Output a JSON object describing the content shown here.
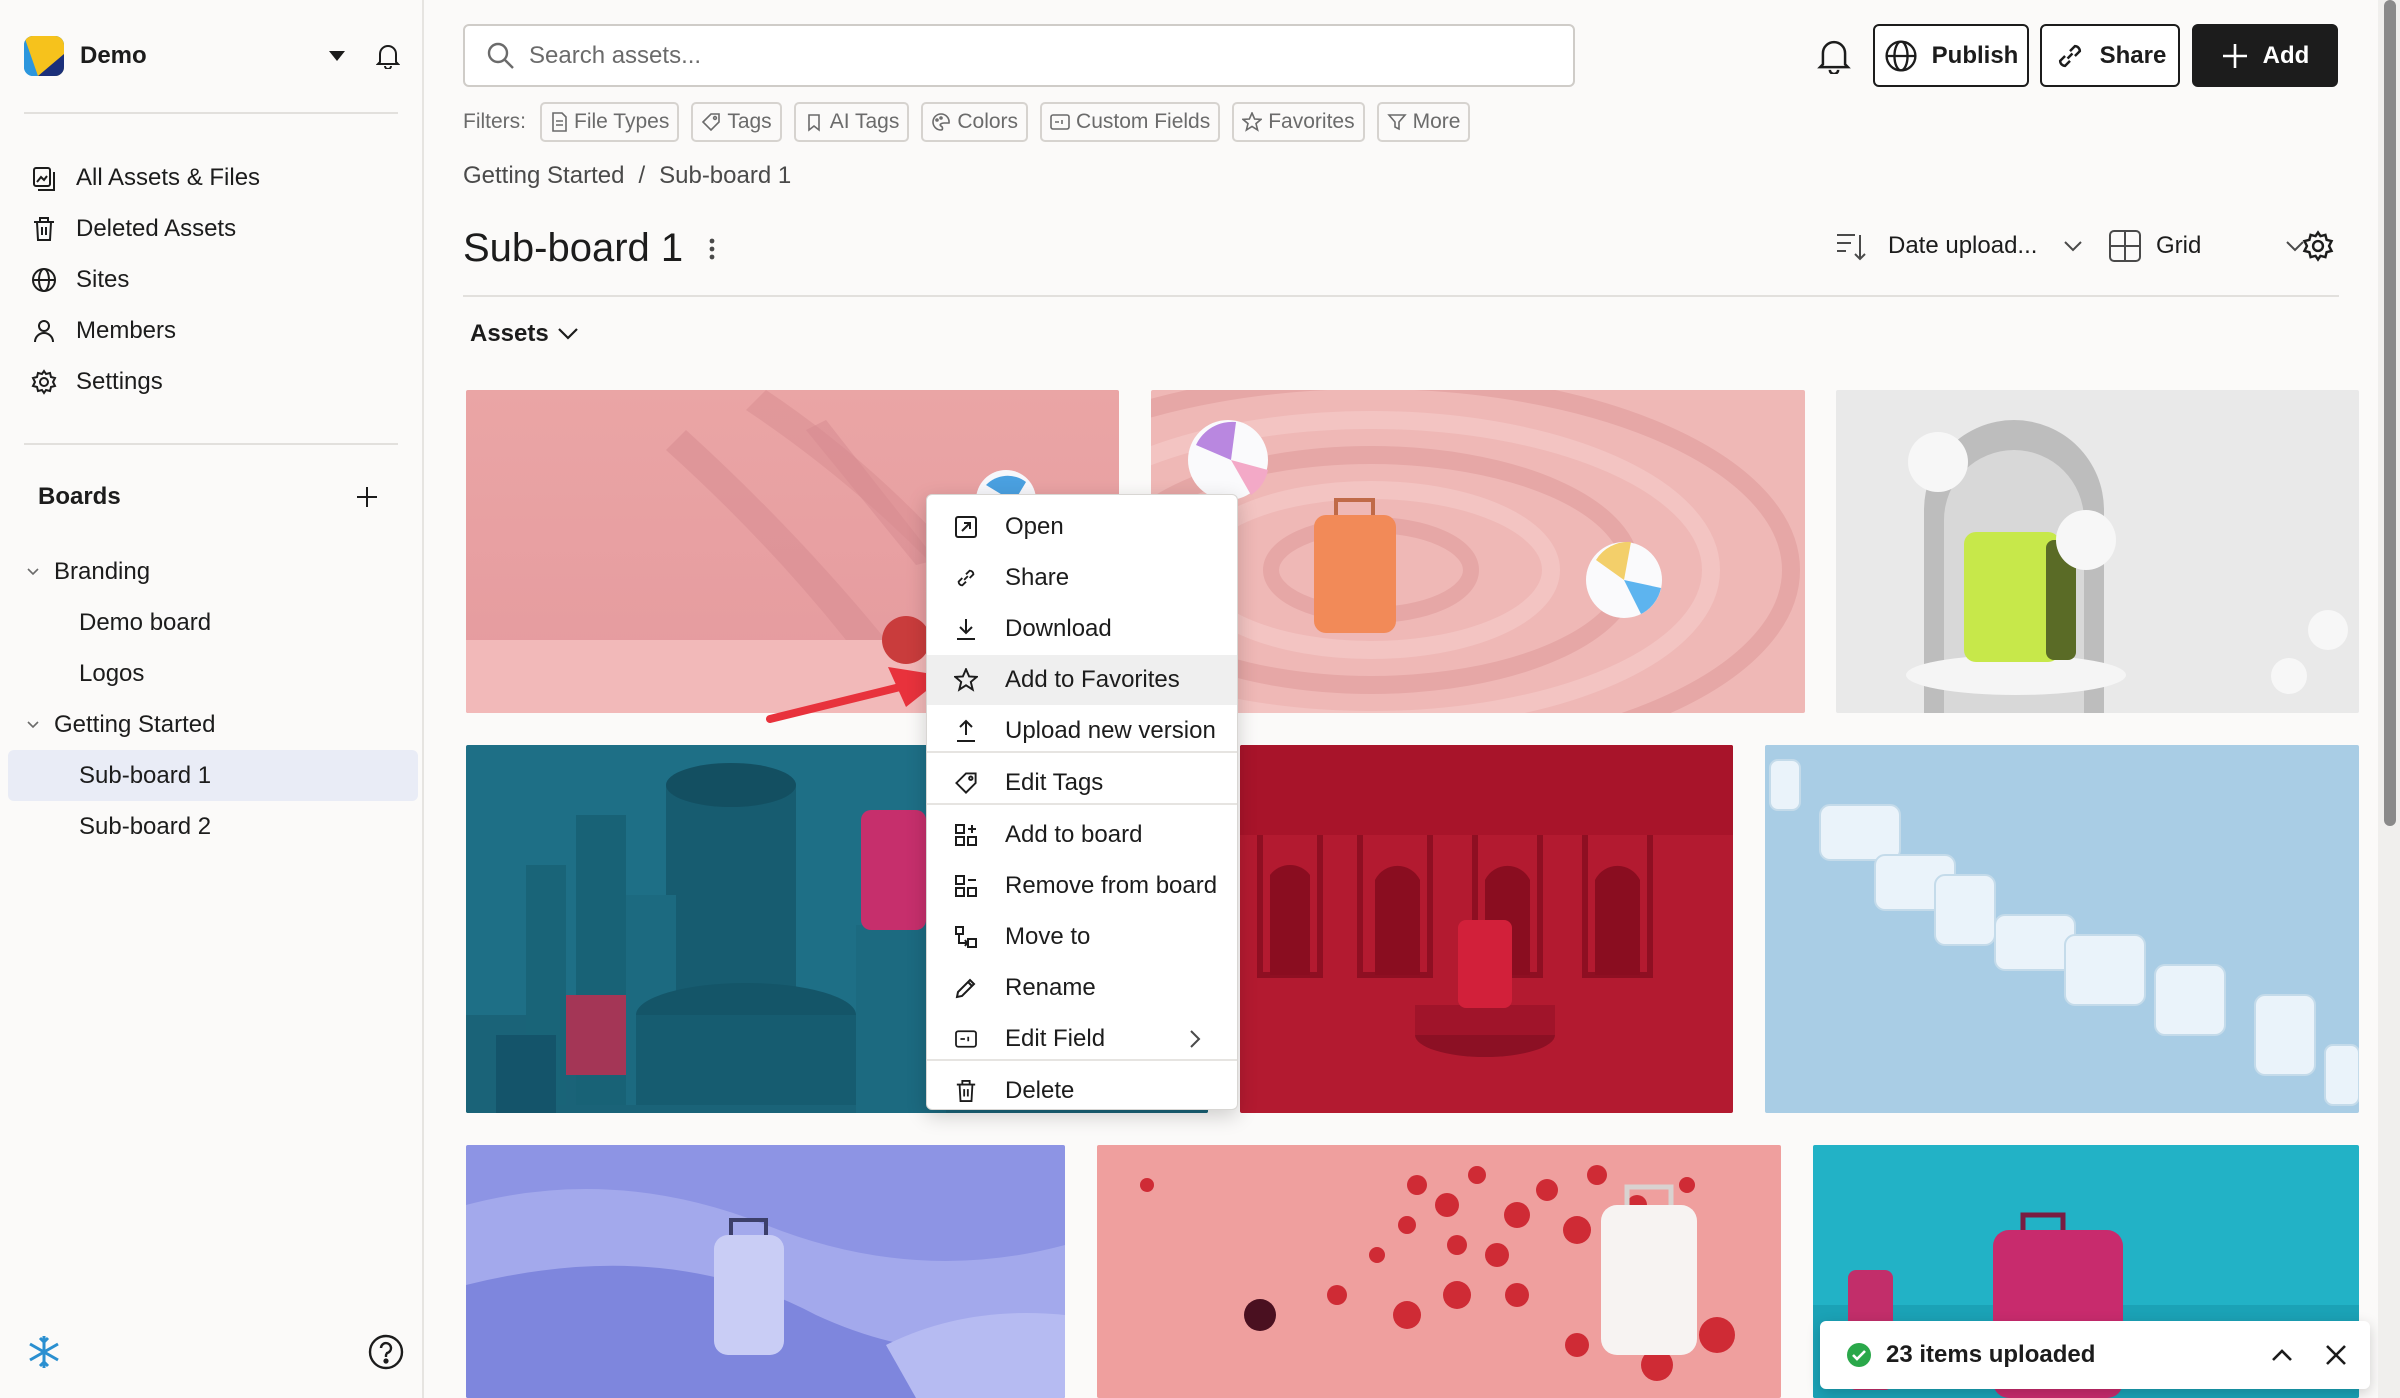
{
  "workspace": {
    "name": "Demo"
  },
  "nav": [
    {
      "label": "All Assets & Files",
      "icon": "assets-icon"
    },
    {
      "label": "Deleted Assets",
      "icon": "trash-icon"
    },
    {
      "label": "Sites",
      "icon": "globe-icon"
    },
    {
      "label": "Members",
      "icon": "person-icon"
    },
    {
      "label": "Settings",
      "icon": "gear-icon"
    }
  ],
  "boards": {
    "heading": "Boards",
    "tree": [
      {
        "label": "Branding",
        "level": 1,
        "expanded": true
      },
      {
        "label": "Demo board",
        "level": 2
      },
      {
        "label": "Logos",
        "level": 2
      },
      {
        "label": "Getting Started",
        "level": 1,
        "expanded": true
      },
      {
        "label": "Sub-board 1",
        "level": 2,
        "active": true
      },
      {
        "label": "Sub-board 2",
        "level": 2
      }
    ]
  },
  "search": {
    "placeholder": "Search assets..."
  },
  "header_buttons": {
    "publish": "Publish",
    "share": "Share",
    "add": "Add"
  },
  "filters": {
    "label": "Filters:",
    "chips": [
      "File Types",
      "Tags",
      "AI Tags",
      "Colors",
      "Custom Fields",
      "Favorites",
      "More"
    ]
  },
  "breadcrumb": [
    "Getting Started",
    "Sub-board 1"
  ],
  "page_title": "Sub-board 1",
  "toolbar": {
    "sort": "Date upload...",
    "view": "Grid"
  },
  "section": {
    "assets_label": "Assets"
  },
  "context_menu": {
    "items": [
      {
        "label": "Open",
        "icon": "open-icon"
      },
      {
        "label": "Share",
        "icon": "link-icon"
      },
      {
        "label": "Download",
        "icon": "download-icon"
      },
      {
        "label": "Add to Favorites",
        "icon": "star-icon",
        "highlighted": true
      },
      {
        "label": "Upload new version",
        "icon": "upload-icon"
      },
      {
        "label": "Edit Tags",
        "icon": "tag-icon"
      },
      {
        "label": "Add to board",
        "icon": "add-board-icon"
      },
      {
        "label": "Remove from board",
        "icon": "remove-board-icon"
      },
      {
        "label": "Move to",
        "icon": "move-icon"
      },
      {
        "label": "Rename",
        "icon": "pencil-icon"
      },
      {
        "label": "Edit Field",
        "icon": "field-icon",
        "submenu": true
      },
      {
        "label": "Delete",
        "icon": "trash-icon"
      }
    ]
  },
  "toast": {
    "message": "23 items uploaded",
    "status_color": "#2aa84a"
  },
  "colors": {
    "accent": "#1c1c1c",
    "annotation_arrow": "#e8323c",
    "active_row": "#e9ecf6"
  }
}
